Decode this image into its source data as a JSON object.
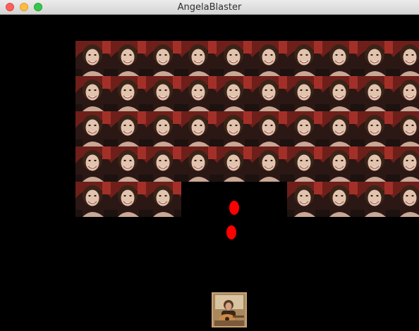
{
  "window": {
    "title": "AngelaBlaster"
  },
  "game": {
    "enemy_grid": {
      "columns": 10,
      "rows": 5,
      "alive": [
        [
          1,
          1,
          1,
          1,
          1,
          1,
          1,
          1,
          1,
          1
        ],
        [
          1,
          1,
          1,
          1,
          1,
          1,
          1,
          1,
          1,
          1
        ],
        [
          1,
          1,
          1,
          1,
          1,
          1,
          1,
          1,
          1,
          1
        ],
        [
          1,
          1,
          1,
          1,
          1,
          1,
          1,
          1,
          1,
          1
        ],
        [
          1,
          1,
          1,
          0,
          0,
          0,
          1,
          1,
          1,
          1
        ]
      ],
      "sprite": "smiling-face-photo"
    },
    "player": {
      "sprite": "guitar-player-photo"
    },
    "bullet_color": "#ff0000"
  }
}
